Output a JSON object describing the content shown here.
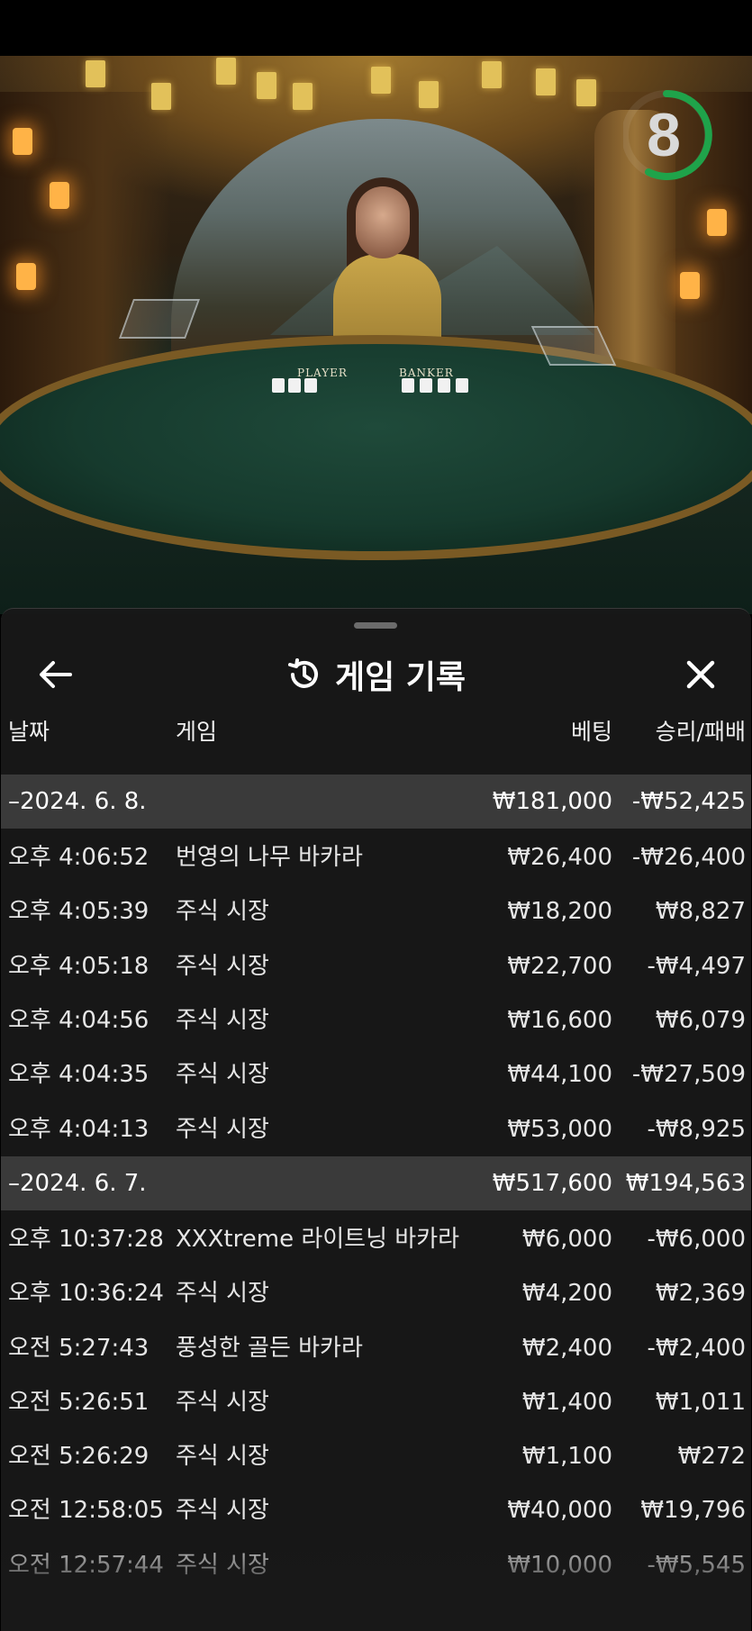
{
  "game_info": {
    "table_labels": {
      "player": "PLAYER",
      "banker": "BANKER"
    },
    "timer_value": "8",
    "timer_color": "#1fa34a"
  },
  "history_panel": {
    "title": "게임 기록",
    "columns": {
      "date": "날짜",
      "game": "게임",
      "bet": "베팅",
      "win_loss": "승리/패배"
    },
    "groups": [
      {
        "date": "–2024. 6. 8.",
        "bet_total": "₩181,000",
        "win_loss_total": "-₩52,425",
        "rows": [
          {
            "time": "오후 4:06:52",
            "game": "번영의 나무 바카라",
            "bet": "₩26,400",
            "win_loss": "-₩26,400"
          },
          {
            "time": "오후 4:05:39",
            "game": "주식 시장",
            "bet": "₩18,200",
            "win_loss": "₩8,827"
          },
          {
            "time": "오후 4:05:18",
            "game": "주식 시장",
            "bet": "₩22,700",
            "win_loss": "-₩4,497"
          },
          {
            "time": "오후 4:04:56",
            "game": "주식 시장",
            "bet": "₩16,600",
            "win_loss": "₩6,079"
          },
          {
            "time": "오후 4:04:35",
            "game": "주식 시장",
            "bet": "₩44,100",
            "win_loss": "-₩27,509"
          },
          {
            "time": "오후 4:04:13",
            "game": "주식 시장",
            "bet": "₩53,000",
            "win_loss": "-₩8,925"
          }
        ]
      },
      {
        "date": "–2024. 6. 7.",
        "bet_total": "₩517,600",
        "win_loss_total": "₩194,563",
        "rows": [
          {
            "time": "오후 10:37:28",
            "game": "XXXtreme 라이트닝 바카라",
            "bet": "₩6,000",
            "win_loss": "-₩6,000"
          },
          {
            "time": "오후 10:36:24",
            "game": "주식 시장",
            "bet": "₩4,200",
            "win_loss": "₩2,369"
          },
          {
            "time": "오전 5:27:43",
            "game": "풍성한 골든 바카라",
            "bet": "₩2,400",
            "win_loss": "-₩2,400"
          },
          {
            "time": "오전 5:26:51",
            "game": "주식 시장",
            "bet": "₩1,400",
            "win_loss": "₩1,011"
          },
          {
            "time": "오전 5:26:29",
            "game": "주식 시장",
            "bet": "₩1,100",
            "win_loss": "₩272"
          },
          {
            "time": "오전 12:58:05",
            "game": "주식 시장",
            "bet": "₩40,000",
            "win_loss": "₩19,796"
          },
          {
            "time": "오전 12:57:44",
            "game": "주식 시장",
            "bet": "₩10,000",
            "win_loss": "-₩5,545"
          }
        ]
      }
    ]
  },
  "icons": {
    "back": "arrow-left-icon",
    "history": "history-clock-icon",
    "close": "close-icon"
  }
}
